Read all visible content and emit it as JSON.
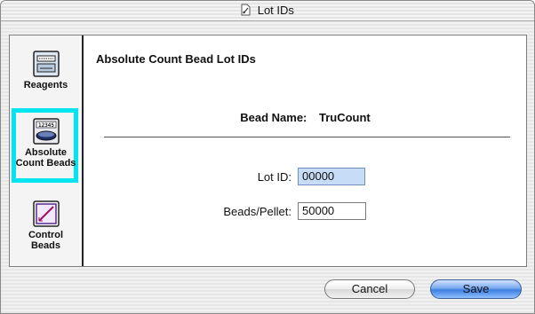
{
  "window": {
    "title": "Lot IDs"
  },
  "sidebar": {
    "items": [
      {
        "label": "Reagents",
        "icon": "reagents-icon"
      },
      {
        "label_line1": "Absolute",
        "label_line2": "Count Beads",
        "icon": "absolute-count-beads-icon",
        "selected": true
      },
      {
        "label_line1": "Control",
        "label_line2": "Beads",
        "icon": "control-beads-icon"
      }
    ]
  },
  "main": {
    "heading": "Absolute Count Bead Lot IDs",
    "bead_name_label": "Bead Name:",
    "bead_name_value": "TruCount",
    "lot_id_label": "Lot ID:",
    "lot_id_value": "00000",
    "beads_per_pellet_label": "Beads/Pellet:",
    "beads_per_pellet_value": "50000"
  },
  "buttons": {
    "cancel": "Cancel",
    "save": "Save"
  },
  "colors": {
    "selection_highlight": "#00e5f0",
    "focused_field": "#c7dcf6",
    "save_button": "#4a86e8"
  }
}
